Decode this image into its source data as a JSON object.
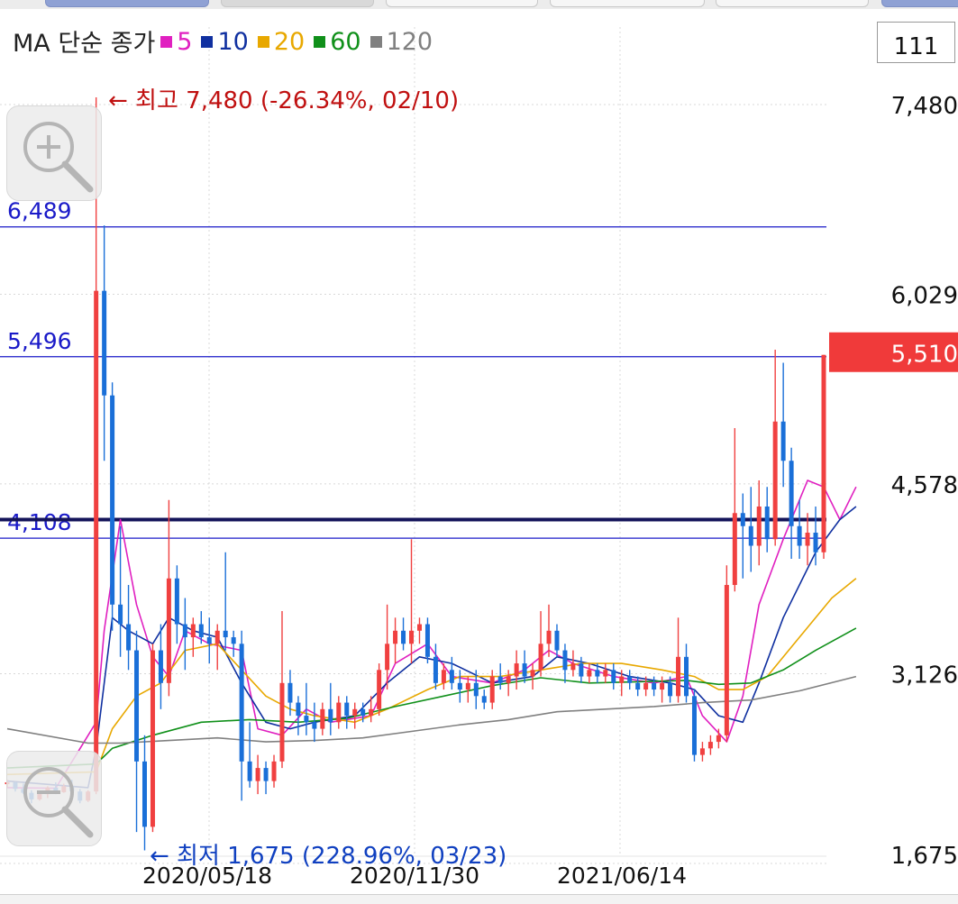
{
  "legend": {
    "title": "MA 단순 종가",
    "items": [
      {
        "label": "5",
        "color": "#e020c0"
      },
      {
        "label": "10",
        "color": "#1030a0"
      },
      {
        "label": "20",
        "color": "#e8a800"
      },
      {
        "label": "60",
        "color": "#10901a"
      },
      {
        "label": "120",
        "color": "#808080"
      }
    ]
  },
  "count_box": "111",
  "icons": {
    "zoom_in": "zoom-in-icon",
    "zoom_out": "zoom-out-icon"
  },
  "chart_data": {
    "type": "candlestick",
    "y_ticks": [
      "7,480",
      "6,029",
      "4,578",
      "3,126",
      "1,675"
    ],
    "y_tick_values": [
      7480,
      6029,
      4578,
      3126,
      1675
    ],
    "ylim": [
      1675,
      7480
    ],
    "x_ticks": [
      "2020/05/18",
      "2020/11/30",
      "2021/06/14"
    ],
    "current_price": {
      "label": "5,510",
      "value": 5510,
      "color": "#f03a3a"
    },
    "high_marker": {
      "text": "← 최고 7,480 (-26.34%, 02/10)",
      "value": 7480,
      "color": "#c01010"
    },
    "low_marker": {
      "text": "← 최저 1,675 (228.96%, 03/23)",
      "value": 1675,
      "color": "#1040c0"
    },
    "horizontal_lines": [
      {
        "label": "6,489",
        "value": 6489,
        "color": "#1a1ac8",
        "weight": "thin"
      },
      {
        "label": "5,496",
        "value": 5496,
        "color": "#1a1ac8",
        "weight": "thin"
      },
      {
        "label": "4,108",
        "value": 4108,
        "color": "#1a1ac8",
        "weight": "thin"
      },
      {
        "label": "",
        "value": 4250,
        "color": "#14145a",
        "weight": "thick"
      }
    ],
    "up_color": "#f04040",
    "down_color": "#1a6fd8",
    "candles": [
      [
        2230,
        2260,
        2200,
        2240
      ],
      [
        2240,
        2245,
        2170,
        2190
      ],
      [
        2190,
        2230,
        2150,
        2160
      ],
      [
        2160,
        2180,
        2080,
        2110
      ],
      [
        2110,
        2170,
        2100,
        2150
      ],
      [
        2150,
        2210,
        2120,
        2200
      ],
      [
        2200,
        2240,
        2150,
        2165
      ],
      [
        2165,
        2230,
        2160,
        2210
      ],
      [
        2210,
        2260,
        2150,
        2170
      ],
      [
        2170,
        2190,
        2080,
        2100
      ],
      [
        2100,
        2180,
        2090,
        2170
      ],
      [
        2170,
        7480,
        2150,
        6000
      ],
      [
        6000,
        6500,
        4700,
        5200
      ],
      [
        5200,
        5300,
        3400,
        3600
      ],
      [
        3600,
        4200,
        3200,
        3450
      ],
      [
        3450,
        3750,
        3100,
        3250
      ],
      [
        3250,
        3400,
        1860,
        2400
      ],
      [
        2400,
        2600,
        1720,
        1900
      ],
      [
        1900,
        3300,
        1860,
        3250
      ],
      [
        3250,
        3450,
        2800,
        3000
      ],
      [
        3000,
        4400,
        2900,
        3800
      ],
      [
        3800,
        3900,
        3300,
        3450
      ],
      [
        3450,
        3650,
        3100,
        3350
      ],
      [
        3350,
        3500,
        3200,
        3450
      ],
      [
        3450,
        3550,
        3300,
        3350
      ],
      [
        3350,
        3500,
        3150,
        3300
      ],
      [
        3300,
        3450,
        3100,
        3400
      ],
      [
        3400,
        4000,
        3250,
        3350
      ],
      [
        3350,
        3400,
        3200,
        3300
      ],
      [
        3300,
        3400,
        2100,
        2400
      ],
      [
        2400,
        2700,
        2200,
        2250
      ],
      [
        2250,
        2450,
        2150,
        2350
      ],
      [
        2350,
        2400,
        2150,
        2250
      ],
      [
        2250,
        2450,
        2200,
        2400
      ],
      [
        2400,
        3550,
        2350,
        3000
      ],
      [
        3000,
        3100,
        2750,
        2850
      ],
      [
        2850,
        2900,
        2600,
        2750
      ],
      [
        2750,
        3000,
        2600,
        2700
      ],
      [
        2700,
        2850,
        2550,
        2650
      ],
      [
        2650,
        2850,
        2600,
        2800
      ],
      [
        2800,
        3000,
        2600,
        2700
      ],
      [
        2700,
        2900,
        2650,
        2850
      ],
      [
        2850,
        2900,
        2650,
        2750
      ],
      [
        2750,
        2850,
        2650,
        2800
      ],
      [
        2800,
        2850,
        2700,
        2750
      ],
      [
        2750,
        2900,
        2700,
        2800
      ],
      [
        2800,
        3150,
        2750,
        3100
      ],
      [
        3100,
        3600,
        2950,
        3300
      ],
      [
        3300,
        3500,
        3150,
        3400
      ],
      [
        3400,
        3500,
        3250,
        3300
      ],
      [
        3300,
        4100,
        3150,
        3400
      ],
      [
        3400,
        3500,
        3300,
        3450
      ],
      [
        3450,
        3500,
        3150,
        3200
      ],
      [
        3200,
        3300,
        2950,
        3000
      ],
      [
        3000,
        3150,
        2950,
        3100
      ],
      [
        3100,
        3200,
        2950,
        3000
      ],
      [
        3000,
        3100,
        2850,
        2950
      ],
      [
        2950,
        3050,
        2850,
        3000
      ],
      [
        3000,
        3100,
        2800,
        2900
      ],
      [
        2900,
        2950,
        2800,
        2850
      ],
      [
        2850,
        3100,
        2800,
        3050
      ],
      [
        3050,
        3150,
        2950,
        3000
      ],
      [
        3000,
        3100,
        2900,
        3050
      ],
      [
        3050,
        3250,
        2950,
        3150
      ],
      [
        3150,
        3250,
        3000,
        3050
      ],
      [
        3050,
        3150,
        2950,
        3100
      ],
      [
        3100,
        3550,
        3050,
        3300
      ],
      [
        3300,
        3600,
        3200,
        3400
      ],
      [
        3400,
        3450,
        3200,
        3250
      ],
      [
        3250,
        3300,
        3000,
        3100
      ],
      [
        3100,
        3250,
        3050,
        3150
      ],
      [
        3150,
        3200,
        3000,
        3050
      ],
      [
        3050,
        3150,
        3000,
        3100
      ],
      [
        3100,
        3150,
        3000,
        3050
      ],
      [
        3050,
        3150,
        3000,
        3100
      ],
      [
        3100,
        3150,
        2950,
        3000
      ],
      [
        3000,
        3100,
        2900,
        3050
      ],
      [
        3050,
        3100,
        2950,
        3000
      ],
      [
        3000,
        3050,
        2900,
        2950
      ],
      [
        2950,
        3050,
        2900,
        3000
      ],
      [
        3000,
        3050,
        2900,
        2950
      ],
      [
        2950,
        3050,
        2850,
        3000
      ],
      [
        3000,
        3050,
        2850,
        2900
      ],
      [
        2900,
        3500,
        2850,
        3200
      ],
      [
        3200,
        3300,
        2850,
        2900
      ],
      [
        2900,
        2950,
        2400,
        2450
      ],
      [
        2450,
        2550,
        2400,
        2500
      ],
      [
        2500,
        2600,
        2450,
        2550
      ],
      [
        2550,
        2650,
        2500,
        2600
      ],
      [
        2600,
        3900,
        2550,
        3750
      ],
      [
        3750,
        4950,
        3700,
        4300
      ],
      [
        4300,
        4450,
        3800,
        4200
      ],
      [
        4200,
        4500,
        3850,
        4050
      ],
      [
        4050,
        4550,
        3900,
        4350
      ],
      [
        4350,
        4500,
        4000,
        4100
      ],
      [
        4100,
        5550,
        4050,
        5000
      ],
      [
        5000,
        5450,
        4500,
        4700
      ],
      [
        4700,
        4800,
        3950,
        4200
      ],
      [
        4200,
        4400,
        3950,
        4050
      ],
      [
        4050,
        4300,
        3900,
        4150
      ],
      [
        4150,
        4350,
        3900,
        4000
      ],
      [
        4000,
        5510,
        3950,
        5510
      ]
    ],
    "ma_lines": [
      {
        "period": "5",
        "color": "#e020c0",
        "values": [
          [
            0,
            2200
          ],
          [
            6,
            2195
          ],
          [
            11,
            2700
          ],
          [
            12,
            3400
          ],
          [
            14,
            4250
          ],
          [
            16,
            3600
          ],
          [
            18,
            3200
          ],
          [
            20,
            3050
          ],
          [
            22,
            3400
          ],
          [
            25,
            3300
          ],
          [
            29,
            3250
          ],
          [
            31,
            2650
          ],
          [
            34,
            2600
          ],
          [
            37,
            2800
          ],
          [
            40,
            2700
          ],
          [
            45,
            2750
          ],
          [
            48,
            3150
          ],
          [
            52,
            3300
          ],
          [
            55,
            3050
          ],
          [
            60,
            3000
          ],
          [
            64,
            3100
          ],
          [
            67,
            3250
          ],
          [
            70,
            3150
          ],
          [
            75,
            3050
          ],
          [
            80,
            3000
          ],
          [
            84,
            3050
          ],
          [
            86,
            2750
          ],
          [
            89,
            2550
          ],
          [
            91,
            2900
          ],
          [
            93,
            3600
          ],
          [
            96,
            4100
          ],
          [
            99,
            4550
          ],
          [
            101,
            4500
          ],
          [
            103,
            4250
          ],
          [
            105,
            4500
          ]
        ]
      },
      {
        "period": "10",
        "color": "#1030a0",
        "values": [
          [
            0,
            2250
          ],
          [
            10,
            2200
          ],
          [
            11,
            2500
          ],
          [
            13,
            3500
          ],
          [
            15,
            3400
          ],
          [
            18,
            3300
          ],
          [
            20,
            3500
          ],
          [
            23,
            3400
          ],
          [
            26,
            3350
          ],
          [
            29,
            3000
          ],
          [
            32,
            2700
          ],
          [
            35,
            2650
          ],
          [
            38,
            2700
          ],
          [
            43,
            2750
          ],
          [
            47,
            3000
          ],
          [
            51,
            3200
          ],
          [
            55,
            3150
          ],
          [
            60,
            3000
          ],
          [
            65,
            3050
          ],
          [
            68,
            3200
          ],
          [
            72,
            3150
          ],
          [
            77,
            3050
          ],
          [
            82,
            3000
          ],
          [
            85,
            2950
          ],
          [
            88,
            2750
          ],
          [
            91,
            2700
          ],
          [
            93,
            3000
          ],
          [
            96,
            3500
          ],
          [
            100,
            4000
          ],
          [
            103,
            4250
          ],
          [
            105,
            4350
          ]
        ]
      },
      {
        "period": "20",
        "color": "#e8a800",
        "values": [
          [
            0,
            2300
          ],
          [
            11,
            2320
          ],
          [
            13,
            2650
          ],
          [
            16,
            2900
          ],
          [
            19,
            3000
          ],
          [
            22,
            3250
          ],
          [
            26,
            3300
          ],
          [
            29,
            3100
          ],
          [
            32,
            2900
          ],
          [
            35,
            2800
          ],
          [
            38,
            2750
          ],
          [
            43,
            2700
          ],
          [
            47,
            2800
          ],
          [
            52,
            2950
          ],
          [
            56,
            3050
          ],
          [
            61,
            3050
          ],
          [
            66,
            3100
          ],
          [
            71,
            3150
          ],
          [
            76,
            3150
          ],
          [
            81,
            3100
          ],
          [
            85,
            3050
          ],
          [
            88,
            2950
          ],
          [
            91,
            2950
          ],
          [
            94,
            3050
          ],
          [
            98,
            3350
          ],
          [
            102,
            3650
          ],
          [
            105,
            3800
          ]
        ]
      },
      {
        "period": "60",
        "color": "#10901a",
        "values": [
          [
            0,
            2350
          ],
          [
            11,
            2380
          ],
          [
            13,
            2500
          ],
          [
            18,
            2600
          ],
          [
            24,
            2700
          ],
          [
            30,
            2720
          ],
          [
            36,
            2700
          ],
          [
            42,
            2730
          ],
          [
            48,
            2820
          ],
          [
            54,
            2900
          ],
          [
            60,
            2980
          ],
          [
            66,
            3040
          ],
          [
            72,
            3000
          ],
          [
            78,
            3010
          ],
          [
            84,
            3020
          ],
          [
            88,
            2990
          ],
          [
            92,
            3000
          ],
          [
            96,
            3100
          ],
          [
            100,
            3250
          ],
          [
            105,
            3420
          ]
        ]
      },
      {
        "period": "120",
        "color": "#808080",
        "values": [
          [
            0,
            2650
          ],
          [
            10,
            2540
          ],
          [
            14,
            2540
          ],
          [
            20,
            2560
          ],
          [
            26,
            2580
          ],
          [
            32,
            2550
          ],
          [
            38,
            2560
          ],
          [
            44,
            2580
          ],
          [
            50,
            2630
          ],
          [
            56,
            2680
          ],
          [
            62,
            2720
          ],
          [
            68,
            2780
          ],
          [
            74,
            2800
          ],
          [
            80,
            2820
          ],
          [
            86,
            2850
          ],
          [
            92,
            2870
          ],
          [
            98,
            2940
          ],
          [
            105,
            3050
          ]
        ]
      }
    ]
  }
}
